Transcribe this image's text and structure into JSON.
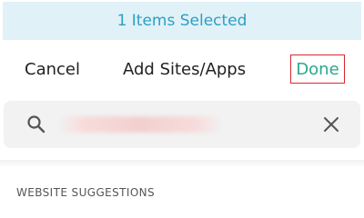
{
  "banner": {
    "selected_text": "1 Items Selected"
  },
  "header": {
    "cancel_label": "Cancel",
    "title": "Add Sites/Apps",
    "done_label": "Done"
  },
  "search": {
    "value": "",
    "icon": "search-icon",
    "clear_icon": "close-icon"
  },
  "suggestions": {
    "section_title": "WEBSITE SUGGESTIONS"
  },
  "colors": {
    "banner_bg": "#e1f1f8",
    "banner_text": "#2aa0c4",
    "done_text": "#2aa98a",
    "highlight_border": "#d8282f"
  }
}
